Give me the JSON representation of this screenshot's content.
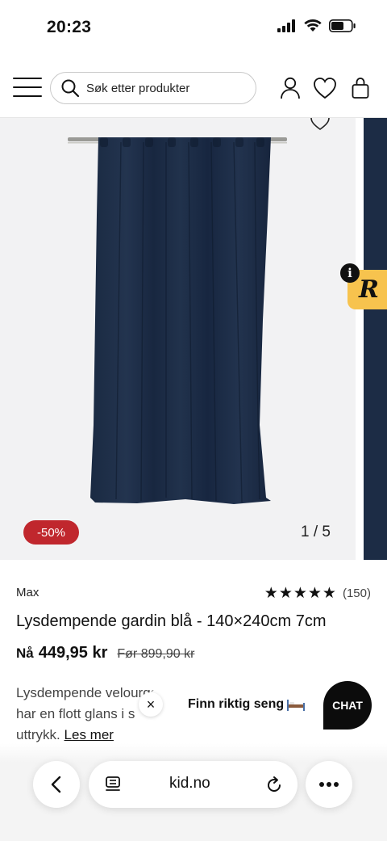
{
  "status_bar": {
    "time": "20:23"
  },
  "header": {
    "search_placeholder": "Søk etter produkter",
    "icons": [
      "menu-icon",
      "search-icon",
      "account-icon",
      "heart-icon",
      "bag-icon"
    ]
  },
  "gallery": {
    "discount": "-50%",
    "counter": "1 / 5",
    "review_badge_letter": "R",
    "info_letter": "i"
  },
  "product": {
    "brand": "Max",
    "rating_stars": "★★★★★",
    "rating_count": "(150)",
    "title": "Lysdempende gardin blå - 140×240cm 7cm",
    "price_label": "Nå",
    "price_now": "449,95 kr",
    "price_before": "Før 899,90 kr",
    "description_line1": "Lysdempende velourgard",
    "description_line2": "har en flott glans i s",
    "description_line2b": "et",
    "description_line3": "uttrykk.",
    "read_more": "Les mer"
  },
  "widgets": {
    "bed_prompt": "Finn riktig seng",
    "bed_close": "×",
    "chat": "CHAT"
  },
  "browser": {
    "url": "kid.no"
  },
  "colors": {
    "discount_badge": "#c0272d",
    "review_tab": "#f7c34e",
    "curtain": "#1c2c45",
    "chat_button": "#0c0c0c"
  }
}
